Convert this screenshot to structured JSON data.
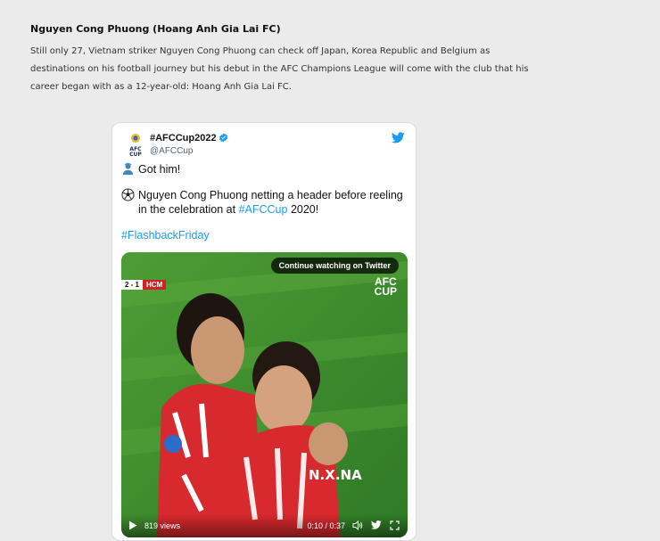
{
  "article": {
    "title": "Nguyen Cong Phuong (Hoang Anh Gia Lai FC)",
    "body": "Still only 27, Vietnam striker Nguyen Cong Phuong can check off Japan, Korea Republic and Belgium as destinations on his football journey but his debut in the AFC Champions League will come with the club that his career began with as a 12-year-old: Hoang Anh Gia Lai FC."
  },
  "tweet": {
    "display_name": "#AFCCup2022",
    "handle": "@AFCCup",
    "avatar_text": "AFC CUP",
    "line1": "Got him!",
    "line2_pre": "Nguyen Cong Phuong netting a header before reeling in the celebration at ",
    "line2_link": "#AFCCup",
    "line2_post": " 2020!",
    "hashtag": "#FlashbackFriday",
    "colors": {
      "link": "#1d9bf0",
      "twitter_blue": "#1d9bf0",
      "verified": "#1d9bf0"
    }
  },
  "video": {
    "continue_label": "Continue watching on Twitter",
    "score": "2 - 1",
    "team": "HCM",
    "logo_line1": "AFC",
    "logo_line2": "CUP",
    "jersey_name": "N.X.NA",
    "views": "819 views",
    "time": "0:10 / 0:37"
  }
}
